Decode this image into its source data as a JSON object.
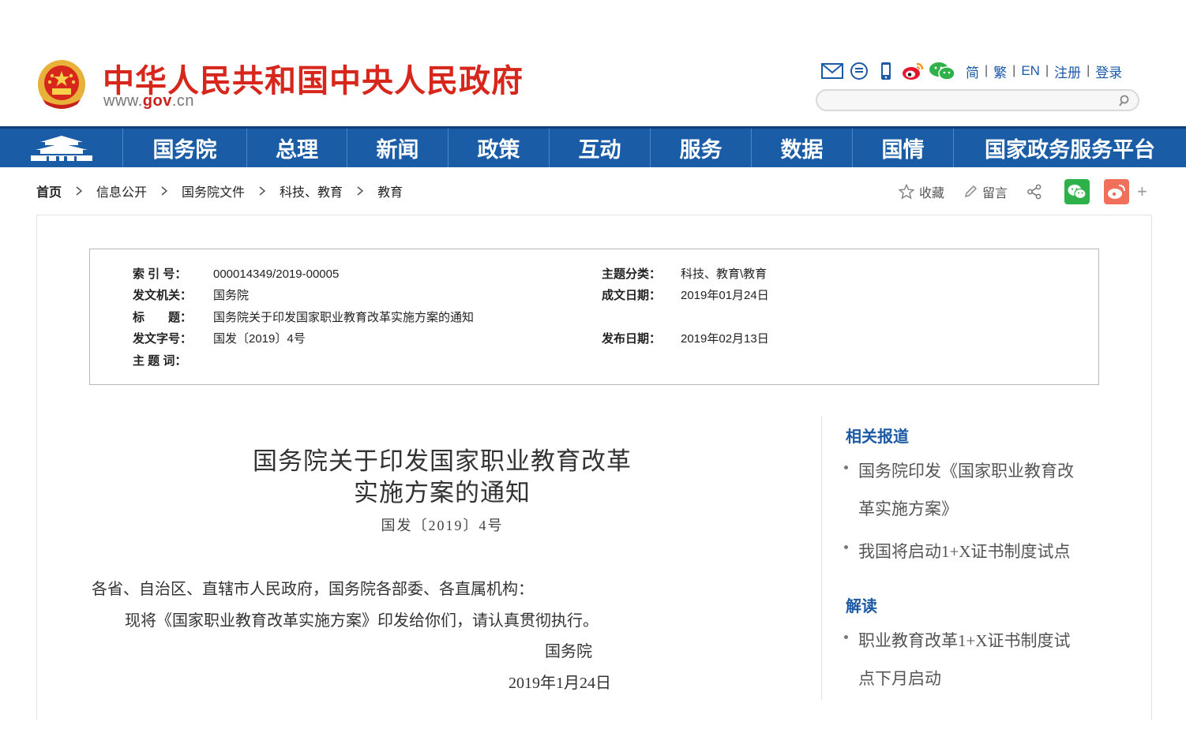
{
  "header": {
    "site_title": "中华人民共和国中央人民政府",
    "site_url_prefix": "www.",
    "site_url_gov": "gov",
    "site_url_suffix": ".cn",
    "tools": [
      "mail-icon",
      "message-icon",
      "mobile-icon",
      "weibo-icon",
      "wechat-icon"
    ],
    "links": {
      "simplified": "简",
      "traditional": "繁",
      "english": "EN",
      "register": "注册",
      "login": "登录"
    },
    "separator": "|",
    "search": {
      "value": "",
      "placeholder": ""
    }
  },
  "nav": {
    "items": [
      "国务院",
      "总理",
      "新闻",
      "政策",
      "互动",
      "服务",
      "数据",
      "国情",
      "国家政务服务平台"
    ]
  },
  "breadcrumb": [
    "首页",
    "信息公开",
    "国务院文件",
    "科技、教育",
    "教育"
  ],
  "share": {
    "favorite": "收藏",
    "comment": "留言",
    "plus": "+"
  },
  "info": {
    "index_label": "索 引 号：",
    "index_value": "000014349/2019-00005",
    "topic_label": "主题分类：",
    "topic_value": "科技、教育\\教育",
    "issuer_label": "发文机关：",
    "issuer_value": "国务院",
    "written_label": "成文日期：",
    "written_value": "2019年01月24日",
    "title_label": "标　　题：",
    "title_value": "国务院关于印发国家职业教育改革实施方案的通知",
    "docno_label": "发文字号：",
    "docno_value": "国发〔2019〕4号",
    "publish_label": "发布日期：",
    "publish_value": "2019年02月13日",
    "keywords_label": "主 题 词：",
    "keywords_value": ""
  },
  "article": {
    "title_line1": "国务院关于印发国家职业教育改革",
    "title_line2": "实施方案的通知",
    "doc_number": "国发〔2019〕4号",
    "salutation": "各省、自治区、直辖市人民政府，国务院各部委、各直属机构：",
    "paragraph1": "现将《国家职业教育改革实施方案》印发给你们，请认真贯彻执行。",
    "signature": "国务院",
    "date": "2019年1月24日"
  },
  "sidebar": {
    "related_heading": "相关报道",
    "related_items": [
      {
        "line1": "国务院印发《国家职业教育改",
        "line2": "革实施方案》"
      },
      {
        "line1": "我国将启动1+X证书制度试点",
        "line2": ""
      }
    ],
    "interpret_heading": "解读",
    "interpret_items": [
      {
        "line1": "职业教育改革1+X证书制度试",
        "line2": "点下月启动"
      }
    ]
  },
  "colors": {
    "brand_red": "#d7261c",
    "nav_blue": "#1a5ca6",
    "link_blue": "#1c5aa6",
    "wechat_green": "#2fb14a",
    "weibo_orange": "#f0705c"
  }
}
